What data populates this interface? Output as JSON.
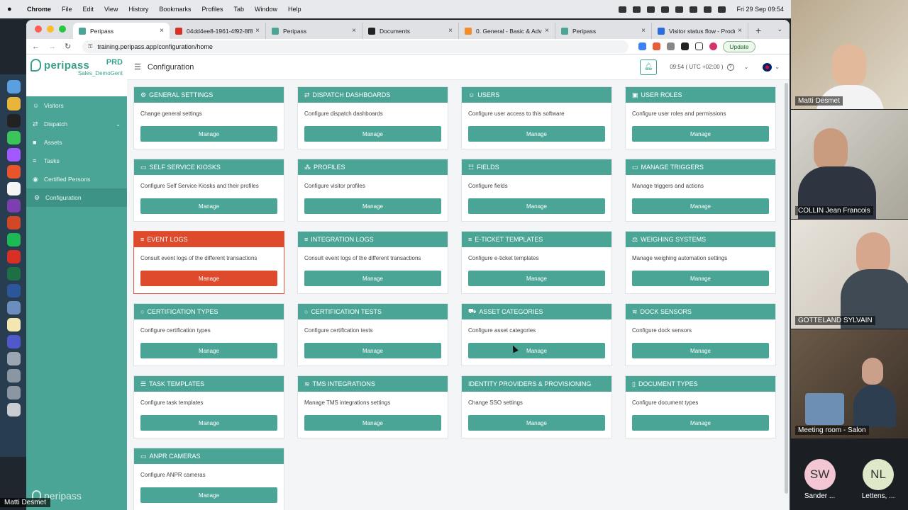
{
  "menubar": {
    "app": "Chrome",
    "items": [
      "File",
      "Edit",
      "View",
      "History",
      "Bookmarks",
      "Profiles",
      "Tab",
      "Window",
      "Help"
    ],
    "clock": "Fri 29 Sep  09:54"
  },
  "browser": {
    "tabs": [
      {
        "label": "Peripass",
        "active": true,
        "color": "#4aa596"
      },
      {
        "label": "04dd4ee8-1961-4f92-8f8",
        "active": false,
        "color": "#d93025"
      },
      {
        "label": "Peripass",
        "active": false,
        "color": "#4aa596"
      },
      {
        "label": "Documents",
        "active": false,
        "color": "#222222"
      },
      {
        "label": "0. General - Basic & Advan",
        "active": false,
        "color": "#f28c28"
      },
      {
        "label": "Peripass",
        "active": false,
        "color": "#4aa596"
      },
      {
        "label": "Visitor status flow - Produc",
        "active": false,
        "color": "#2b6cde"
      }
    ],
    "url": "training.peripass.app/configuration/home",
    "update_label": "Update"
  },
  "brand": {
    "name": "peripass",
    "env": "PRD",
    "tenant": "Sales_DemoGent"
  },
  "sidebar": {
    "items": [
      {
        "label": "Visitors",
        "icon": "☺",
        "active": false
      },
      {
        "label": "Dispatch",
        "icon": "⇄",
        "active": false
      },
      {
        "label": "Assets",
        "icon": "■",
        "active": false
      },
      {
        "label": "Tasks",
        "icon": "≡",
        "active": false
      },
      {
        "label": "Certified Persons",
        "icon": "◉",
        "active": false
      },
      {
        "label": "Configuration",
        "icon": "⚙",
        "active": true
      }
    ]
  },
  "topbar": {
    "title": "Configuration",
    "timezone": "09:54 ( UTC +02:00 )"
  },
  "cards": [
    {
      "title": "General Settings",
      "icon": "⚙",
      "desc": "Change general settings",
      "button": "Manage"
    },
    {
      "title": "Dispatch Dashboards",
      "icon": "⇄",
      "desc": "Configure dispatch dashboards",
      "button": "Manage"
    },
    {
      "title": "Users",
      "icon": "☺",
      "desc": "Configure user access to this software",
      "button": "Manage"
    },
    {
      "title": "User Roles",
      "icon": "▣",
      "desc": "Configure user roles and permissions",
      "button": "Manage"
    },
    {
      "title": "Self Service Kiosks",
      "icon": "▭",
      "desc": "Configure Self Service Kiosks and their profiles",
      "button": "Manage"
    },
    {
      "title": "Profiles",
      "icon": "⁂",
      "desc": "Configure visitor profiles",
      "button": "Manage"
    },
    {
      "title": "Fields",
      "icon": "☷",
      "desc": "Configure fields",
      "button": "Manage"
    },
    {
      "title": "Manage Triggers",
      "icon": "▭",
      "desc": "Manage triggers and actions",
      "button": "Manage"
    },
    {
      "title": "Event Logs",
      "icon": "≡",
      "desc": "Consult event logs of the different transactions",
      "button": "Manage"
    },
    {
      "title": "Integration Logs",
      "icon": "≡",
      "desc": "Consult event logs of the different transactions",
      "button": "Manage"
    },
    {
      "title": "E-Ticket Templates",
      "icon": "≡",
      "desc": "Configure e-ticket templates",
      "button": "Manage"
    },
    {
      "title": "Weighing Systems",
      "icon": "⚖",
      "desc": "Manage weighing automation settings",
      "button": "Manage"
    },
    {
      "title": "Certification Types",
      "icon": "○",
      "desc": "Configure certification types",
      "button": "Manage"
    },
    {
      "title": "Certification Tests",
      "icon": "○",
      "desc": "Configure certification tests",
      "button": "Manage"
    },
    {
      "title": "Asset Categories",
      "icon": "⛟",
      "desc": "Configure asset categories",
      "button": "Manage"
    },
    {
      "title": "Dock Sensors",
      "icon": "≋",
      "desc": "Configure dock sensors",
      "button": "Manage"
    },
    {
      "title": "Task Templates",
      "icon": "☰",
      "desc": "Configure task templates",
      "button": "Manage"
    },
    {
      "title": "TMS Integrations",
      "icon": "≋",
      "desc": "Manage TMS integrations settings",
      "button": "Manage"
    },
    {
      "title": "Identity Providers & Provisioning",
      "icon": "",
      "desc": "Change SSO settings",
      "button": "Manage"
    },
    {
      "title": "Document Types",
      "icon": "▯",
      "desc": "Configure document types",
      "button": "Manage"
    },
    {
      "title": "ANPR Cameras",
      "icon": "▭",
      "desc": "Configure ANPR cameras",
      "button": "Manage"
    }
  ],
  "presenter": "Matti Desmet",
  "video_tiles": [
    {
      "name": "Matti Desmet"
    },
    {
      "name": "COLLIN Jean Francois"
    },
    {
      "name": "GOTTELAND SYLVAIN"
    },
    {
      "name": "Meeting room - Salon"
    }
  ],
  "participants": [
    {
      "initials": "SW",
      "name": "Sander ...",
      "color": "#f3c6d3"
    },
    {
      "initials": "NL",
      "name": "Lettens, ...",
      "color": "#dfe8c8"
    }
  ]
}
